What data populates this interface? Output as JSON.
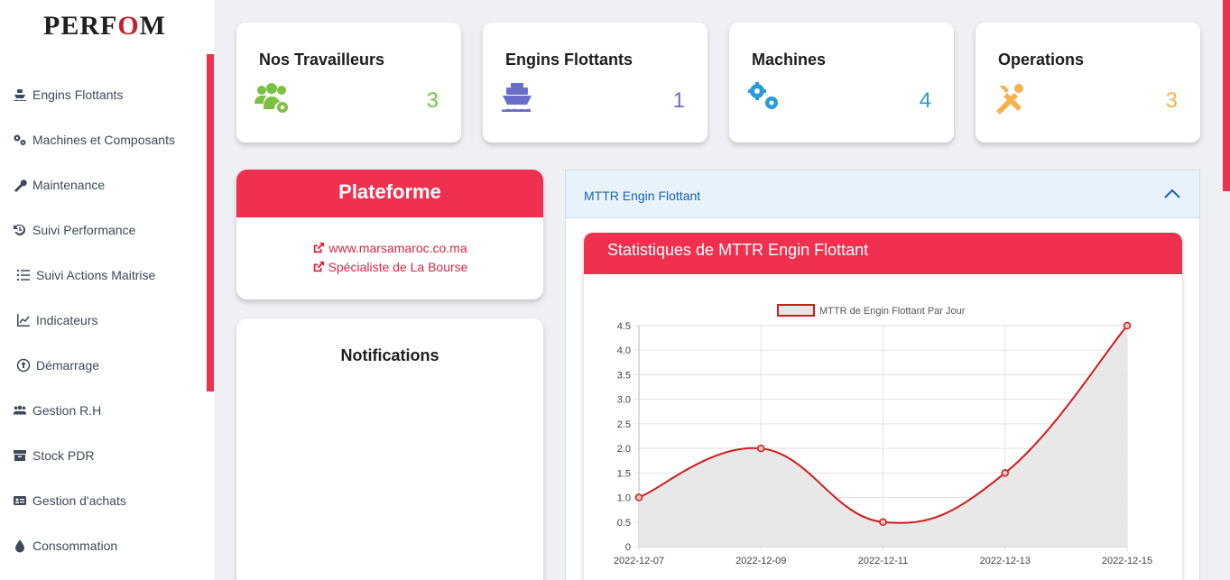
{
  "sidebar": {
    "logo": {
      "prefix": "PERF",
      "o": "O",
      "suffix": "M"
    },
    "items": [
      {
        "label": "Engins Flottants",
        "icon": "ship-icon"
      },
      {
        "label": "Machines et Composants",
        "icon": "cogs-icon"
      },
      {
        "label": "Maintenance",
        "icon": "wrench-icon"
      },
      {
        "label": "Suivi Performance",
        "icon": "history-icon"
      },
      {
        "label": "Suivi Actions Maitrise",
        "icon": "list-icon"
      },
      {
        "label": "Indicateurs",
        "icon": "line-chart-icon"
      },
      {
        "label": "Démarrage",
        "icon": "arrow-circle-up-icon"
      },
      {
        "label": "Gestion R.H",
        "icon": "users-icon"
      },
      {
        "label": "Stock PDR",
        "icon": "archive-icon"
      },
      {
        "label": "Gestion d'achats",
        "icon": "id-card-icon"
      },
      {
        "label": "Consommation",
        "icon": "droplet-icon"
      }
    ]
  },
  "stats": [
    {
      "title": "Nos Travailleurs",
      "value": "3",
      "icon": "users-cog-icon",
      "color": "#7ac143"
    },
    {
      "title": "Engins Flottants",
      "value": "1",
      "icon": "ship-icon",
      "color": "#6a6ec9"
    },
    {
      "title": "Machines",
      "value": "4",
      "icon": "cogs-icon",
      "color": "#2b9bd6"
    },
    {
      "title": "Operations",
      "value": "3",
      "icon": "tools-icon",
      "color": "#f5b14a"
    }
  ],
  "plateforme": {
    "title": "Plateforme",
    "links": [
      "www.marsamaroc.co.ma",
      "Spécialiste de La Bourse"
    ]
  },
  "notifications": {
    "title": "Notifications"
  },
  "accordion": {
    "label": "MTTR Engin Flottant",
    "icon": "chevron-up-icon"
  },
  "chart_card": {
    "title": "Statistiques de MTTR Engin Flottant"
  },
  "chart_data": {
    "type": "area",
    "title": "",
    "x": [
      "2022-12-07",
      "2022-12-09",
      "2022-12-11",
      "2022-12-13",
      "2022-12-15"
    ],
    "series": [
      {
        "name": "MTTR de Engin Flottant Par Jour",
        "values": [
          1,
          2,
          0.5,
          1.5,
          4.5
        ],
        "color": "#d01c1c",
        "fill": "#e5e5e5"
      }
    ],
    "yticks": [
      "0",
      "0.5",
      "1.0",
      "1.5",
      "2.0",
      "2.5",
      "3.0",
      "3.5",
      "4.0",
      "4.5"
    ],
    "ylim": [
      0,
      4.5
    ],
    "grid": true,
    "legend": "top-center",
    "xlabel": "",
    "ylabel": ""
  },
  "colors": {
    "accent": "#f0304f",
    "link": "#d92745",
    "accordion_text": "#1a63b0"
  }
}
